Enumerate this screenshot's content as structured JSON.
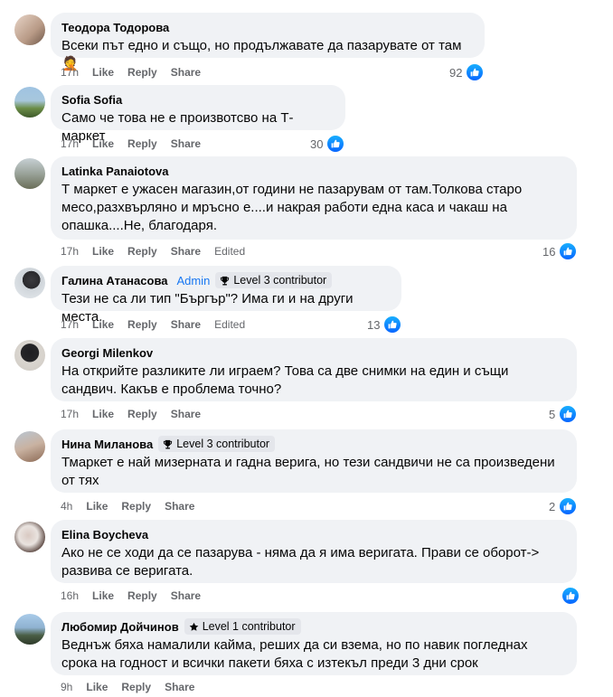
{
  "labels": {
    "like": "Like",
    "reply": "Reply",
    "share": "Share"
  },
  "comments": [
    {
      "author": "Теодора Тодорова",
      "text": "Всеки път едно и също, но продължавате да пазарувате от там 🤦",
      "time": "17h",
      "reactions": "92",
      "avatar_colors": [
        "#d9c3b5",
        "#8e7563"
      ]
    },
    {
      "author": "Sofia Sofia",
      "text": "Само че това не е произвотсво на Т-маркет",
      "time": "17h",
      "reactions": "30",
      "avatar_colors": [
        "#7fa7c9",
        "#5e7d3a"
      ]
    },
    {
      "author": "Latinka Panaiotova",
      "text": "Т маркет е ужасен магазин,от години не пазарувам от там.Толкова старо месо,разхвърляно и мръсно е....и накрая работи една каса и чакаш на опашка....Не, благодаря.",
      "time": "17h",
      "reactions": "16",
      "edited": "Edited",
      "avatar_colors": [
        "#9aa7a0",
        "#6b705b"
      ]
    },
    {
      "author": "Галина Атанасова",
      "admin": "Admin",
      "badge": "Level 3 contributor",
      "text": "Тези не са ли тип \"Бъргър\"? Има ги и на други места.",
      "time": "17h",
      "reactions": "13",
      "edited": "Edited",
      "avatar_colors": [
        "#c9cfd6",
        "#2f2f33"
      ]
    },
    {
      "author": "Georgi Milenkov",
      "text": "На открийте разликите ли играем? Това са две снимки на един и същи сандвич. Какъв е проблема точно?",
      "time": "17h",
      "reactions": "5",
      "avatar_colors": [
        "#d6d2cc",
        "#262626"
      ]
    },
    {
      "author": "Нина Миланова",
      "badge": "Level 3 contributor",
      "text": "Тмаркет е най мизерната и гадна верига, но тези сандвичи не са произведени от тях",
      "time": "4h",
      "reactions": "2",
      "avatar_colors": [
        "#a9b7c6",
        "#8d6e5a"
      ]
    },
    {
      "author": "Elina Boycheva",
      "text": "Ако не се ходи да се пазарува - няма да я има веригата. Прави се оборот-> развива се веригата.",
      "time": "16h",
      "reactions": "",
      "avatar_colors": [
        "#e3dcd8",
        "#4a3a35"
      ]
    },
    {
      "author": "Любомир Дойчинов",
      "badge": "Level 1 contributor",
      "text": "Веднъж бяха намалили кайма, реших да си взема, но по навик погледнах срока на годност и всички пакети бяха с изтекъл преди 3 дни срок",
      "time": "9h",
      "reactions": "",
      "avatar_colors": [
        "#9ec0e0",
        "#3d4b3a"
      ]
    }
  ],
  "colors": {
    "bubble": "#f0f2f5",
    "meta": "#65676b",
    "like_blue": "#0866ff",
    "admin": "#1877f2"
  }
}
